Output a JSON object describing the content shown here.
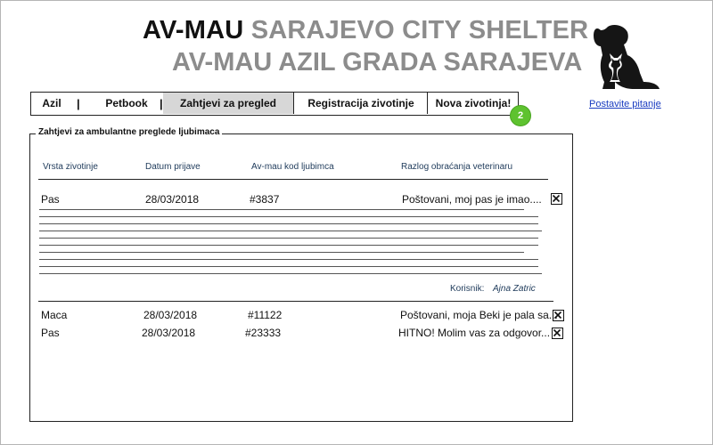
{
  "header": {
    "title_brand": "AV-MAU",
    "title_rest": "SARAJEVO CITY SHELTER",
    "subtitle": "AV-MAU AZIL GRADA SARAJEVA",
    "logo_icon": "cat-dog-silhouette-icon",
    "ask_link": "Postavite pitanje"
  },
  "nav": {
    "items": [
      {
        "label": "Azil"
      },
      {
        "label": "Petbook"
      },
      {
        "label": "Zahtjevi za pregled",
        "active": true
      },
      {
        "label": "Registracija zivotinje"
      },
      {
        "label": "Nova zivotinja!"
      }
    ],
    "separator": "|",
    "badge_count": "2"
  },
  "panel": {
    "legend": "Zahtjevi za ambulantne preglede ljubimaca",
    "columns": [
      "Vrsta zivotinje",
      "Datum prijave",
      "Av-mau kod ljubimca",
      "Razlog obraćanja veterinaru"
    ],
    "expanded": {
      "species": "Pas",
      "date": "28/03/2018",
      "code": "#3837",
      "reason": "Poštovani, moj pas je imao....",
      "user_label": "Korisnik:",
      "user_name": "Ajna Zatric"
    },
    "rows": [
      {
        "species": "Maca",
        "date": "28/03/2018",
        "code": "#11122",
        "reason": "Poštovani, moja Beki je pala sa..."
      },
      {
        "species": "Pas",
        "date": "28/03/2018",
        "code": "#23333",
        "reason": "HITNO! Molim vas za odgovor..."
      }
    ]
  },
  "icons": {
    "delete": "close-box-icon"
  },
  "colors": {
    "accent_green": "#5ec22f",
    "link_blue": "#1a3cc0",
    "title_grey": "#8c8c8c"
  }
}
